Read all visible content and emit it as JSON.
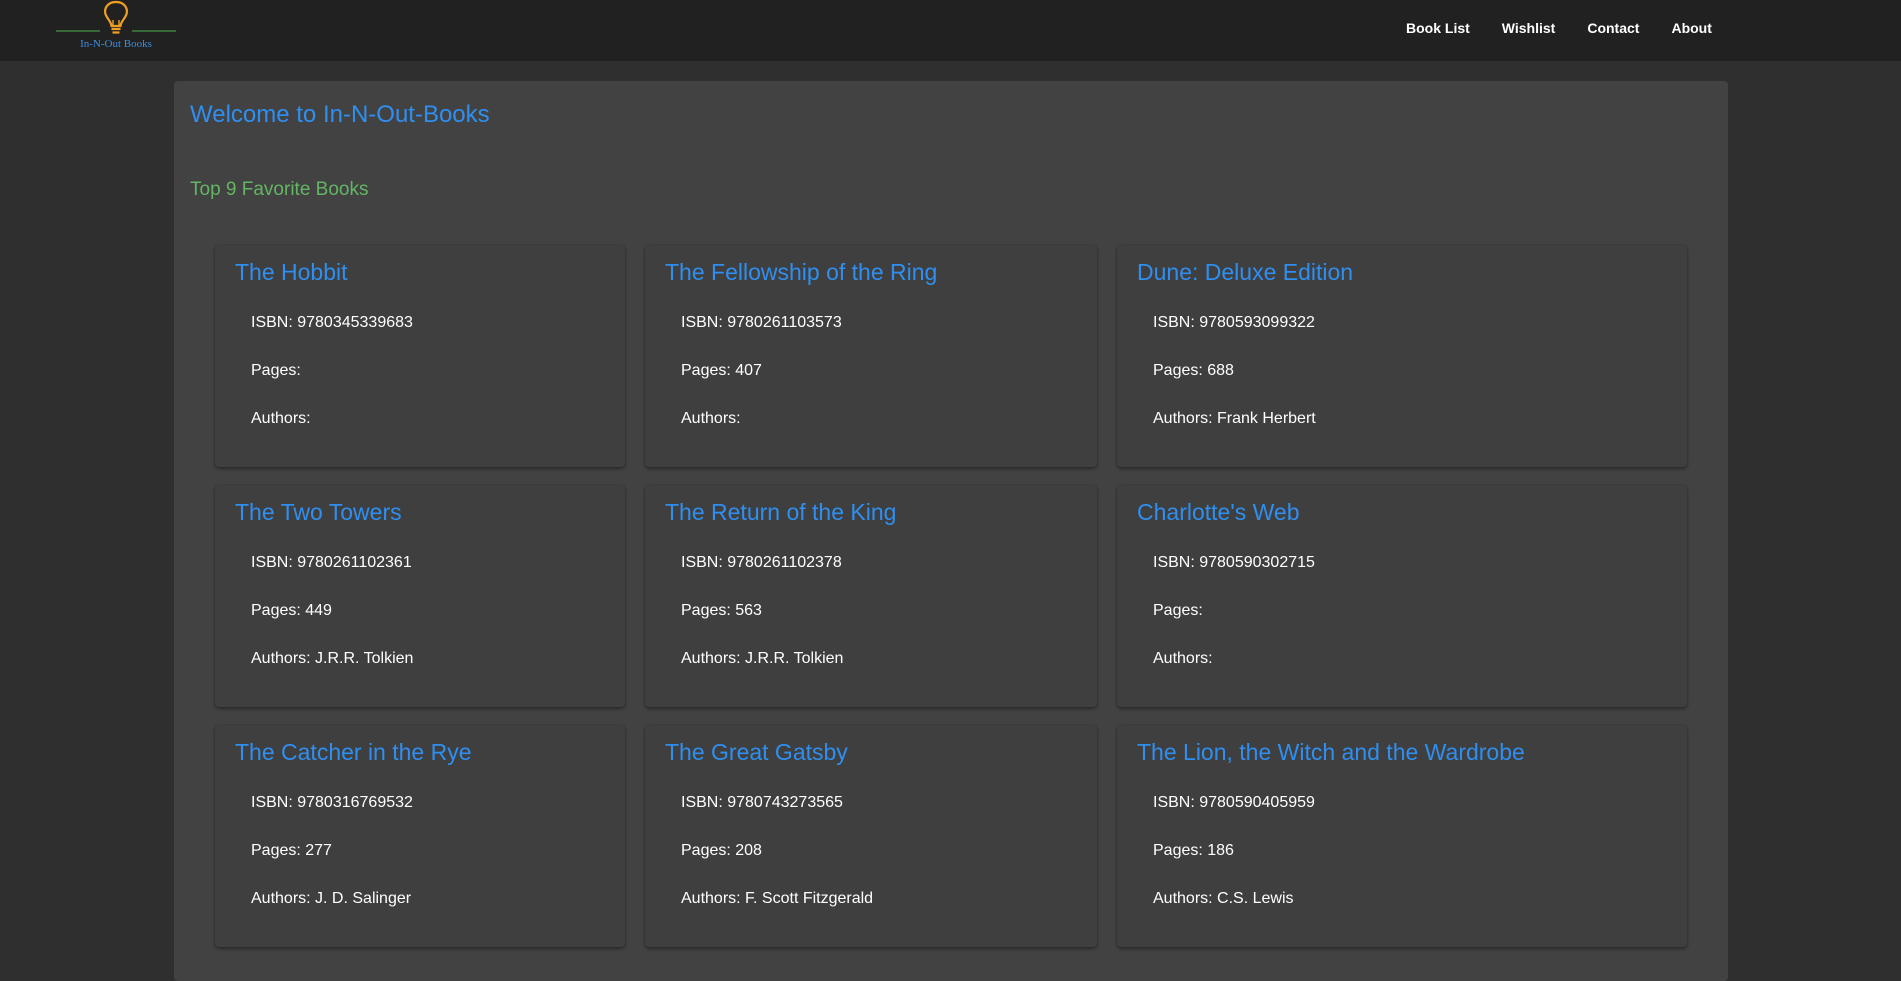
{
  "header": {
    "logo_text": "In-N-Out Books",
    "nav": [
      "Book List",
      "Wishlist",
      "Contact",
      "About"
    ]
  },
  "main": {
    "welcome": "Welcome to In-N-Out-Books",
    "subtitle": "Top 9 Favorite Books",
    "books": [
      {
        "title": "The Hobbit",
        "isbn": "ISBN: 9780345339683",
        "pages": "Pages:",
        "authors": "Authors:"
      },
      {
        "title": "The Fellowship of the Ring",
        "isbn": "ISBN: 9780261103573",
        "pages": "Pages: 407",
        "authors": "Authors:"
      },
      {
        "title": "Dune: Deluxe Edition",
        "isbn": "ISBN: 9780593099322",
        "pages": "Pages: 688",
        "authors": "Authors: Frank Herbert"
      },
      {
        "title": "The Two Towers",
        "isbn": "ISBN: 9780261102361",
        "pages": "Pages: 449",
        "authors": "Authors: J.R.R. Tolkien"
      },
      {
        "title": "The Return of the King",
        "isbn": "ISBN: 9780261102378",
        "pages": "Pages: 563",
        "authors": "Authors: J.R.R. Tolkien"
      },
      {
        "title": "Charlotte's Web",
        "isbn": "ISBN: 9780590302715",
        "pages": "Pages:",
        "authors": "Authors:"
      },
      {
        "title": "The Catcher in the Rye",
        "isbn": "ISBN: 9780316769532",
        "pages": "Pages: 277",
        "authors": "Authors: J. D. Salinger"
      },
      {
        "title": "The Great Gatsby",
        "isbn": "ISBN: 9780743273565",
        "pages": "Pages: 208",
        "authors": "Authors: F. Scott Fitzgerald"
      },
      {
        "title": "The Lion, the Witch and the Wardrobe",
        "isbn": "ISBN: 9780590405959",
        "pages": "Pages: 186",
        "authors": "Authors: C.S. Lewis"
      }
    ]
  },
  "colors": {
    "header_bg": "#212121",
    "page_bg": "#2f2f2f",
    "panel_bg": "#424242",
    "card_bg": "#3f3f3f",
    "title_blue": "#2f8ff0",
    "subtitle_green": "#63b564",
    "logo_orange": "#f0a020"
  },
  "icons": {
    "logo": "lightbulb-icon"
  }
}
